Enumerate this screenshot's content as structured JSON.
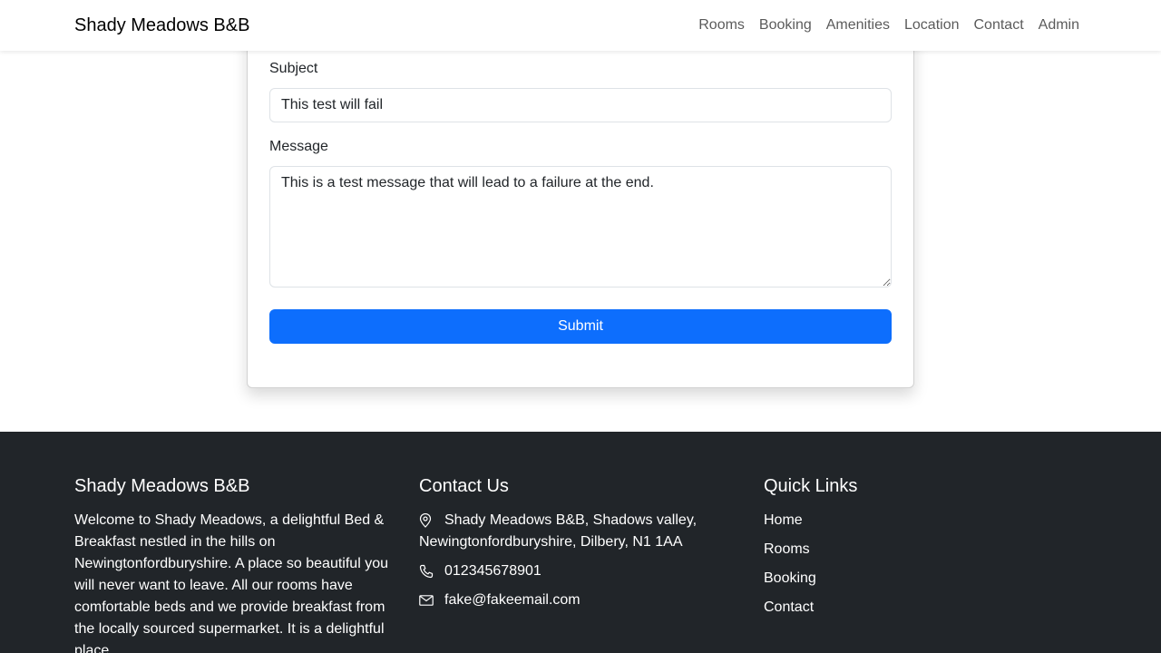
{
  "navbar": {
    "brand": "Shady Meadows B&B",
    "links": [
      "Rooms",
      "Booking",
      "Amenities",
      "Location",
      "Contact",
      "Admin"
    ]
  },
  "contact_form": {
    "subject_label": "Subject",
    "subject_value": "This test will fail",
    "message_label": "Message",
    "message_value": "This is a test message that will lead to a failure at the end.",
    "submit_label": "Submit"
  },
  "footer": {
    "about": {
      "heading": "Shady Meadows B&B",
      "text": "Welcome to Shady Meadows, a delightful Bed & Breakfast nestled in the hills on Newingtonfordburyshire. A place so beautiful you will never want to leave. All our rooms have comfortable beds and we provide breakfast from the locally sourced supermarket. It is a delightful place."
    },
    "contact": {
      "heading": "Contact Us",
      "address": "Shady Meadows B&B, Shadows valley, Newingtonfordburyshire, Dilbery, N1 1AA",
      "phone": "012345678901",
      "email": "fake@fakeemail.com"
    },
    "quick_links": {
      "heading": "Quick Links",
      "links": [
        "Home",
        "Rooms",
        "Booking",
        "Contact"
      ]
    }
  },
  "colors": {
    "primary": "#0d6efd",
    "footer_bg": "#212529",
    "nav_link": "rgba(0,0,0,0.65)"
  },
  "icons": {
    "address": "map-pin-icon",
    "phone": "phone-icon",
    "email": "envelope-icon"
  }
}
